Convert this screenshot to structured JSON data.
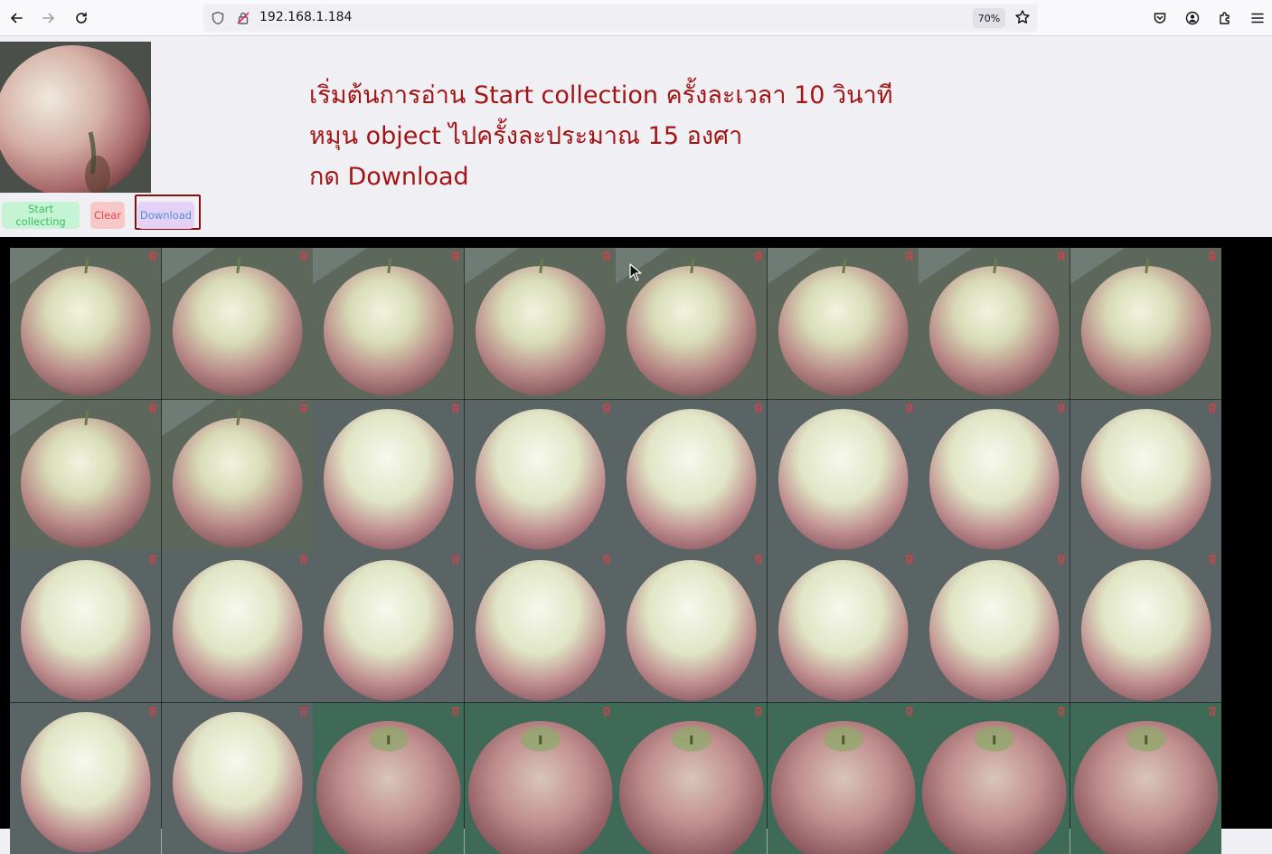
{
  "browser": {
    "url": "192.168.1.184",
    "zoom": "70%",
    "icons": [
      "back-arrow-icon",
      "forward-arrow-icon",
      "reload-icon",
      "shield-icon",
      "insecure-lock-icon",
      "star-icon",
      "pocket-icon",
      "account-icon",
      "extensions-icon",
      "menu-icon"
    ]
  },
  "page": {
    "instructions": [
      "เริ่มต้นการอ่าน Start collection ครั้งละเวลา 10 วินาที",
      "หมุน object ไปครั้งละประมาณ 15 องศา",
      "กด Download"
    ],
    "buttons": {
      "start": "Start collecting",
      "clear": "Clear",
      "download": "Download"
    },
    "colors": {
      "instruction_text": "#a31515",
      "start_bg": "#c5f4d4",
      "clear_bg": "#f8c7c7",
      "download_bg": "#e5d1f6",
      "gallery_bg": "#000000",
      "trash_icon": "#d8414a"
    }
  },
  "gallery": {
    "rows": 4,
    "columns": 8,
    "tile_icon": "trash-icon",
    "views": [
      "top",
      "top",
      "top",
      "top",
      "top",
      "top",
      "top",
      "top",
      "top",
      "top",
      "side",
      "side",
      "side",
      "side",
      "side",
      "side",
      "side",
      "side",
      "side",
      "side",
      "side",
      "side",
      "side",
      "side",
      "side",
      "side",
      "stem",
      "stem",
      "stem",
      "stem",
      "stem",
      "stem"
    ]
  }
}
